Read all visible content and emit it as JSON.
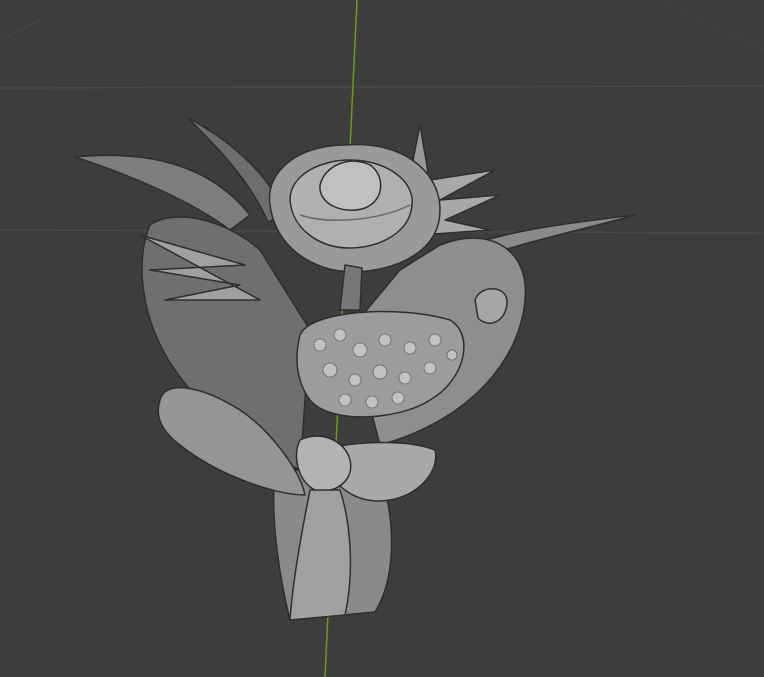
{
  "viewport": {
    "background_color": "#3d3d3d",
    "grid_color": "#4a4a4a",
    "z_axis_color": "#6a9a1f",
    "model_base_color": "#8c8c8c",
    "model_light_color": "#b5b5b5",
    "model_dark_color": "#5a5a5a"
  }
}
